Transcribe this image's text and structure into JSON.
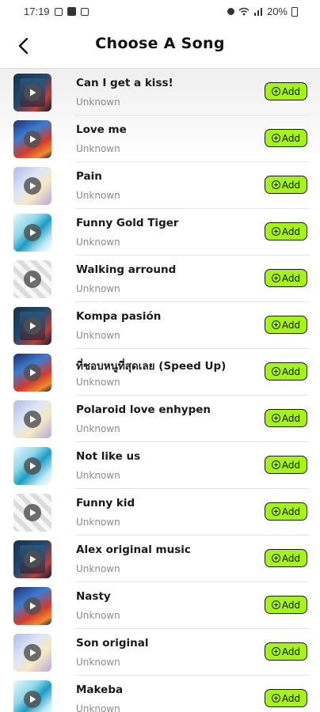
{
  "status_bar": {
    "time": "17:19",
    "battery": "20%",
    "icons": [
      "gallery-icon",
      "check-icon",
      "mail-icon",
      "alarm-icon",
      "wifi-icon",
      "signal-icon",
      "battery-icon"
    ]
  },
  "header": {
    "title": "Choose A Song",
    "back_icon": "arrow-left-icon"
  },
  "songs": [
    {
      "title": "Can I get a kiss!",
      "artist": "Unknown",
      "add_label": "Add",
      "thumb": "dark"
    },
    {
      "title": "Love me",
      "artist": "Unknown",
      "add_label": "Add",
      "thumb": "fire"
    },
    {
      "title": "Pain",
      "artist": "Unknown",
      "add_label": "Add",
      "thumb": "pastel"
    },
    {
      "title": "Funny Gold Tiger",
      "artist": "Unknown",
      "add_label": "Add",
      "thumb": "cyan"
    },
    {
      "title": "Walking arround",
      "artist": "Unknown",
      "add_label": "Add",
      "thumb": "pattern"
    },
    {
      "title": "Kompa pasión",
      "artist": "Unknown",
      "add_label": "Add",
      "thumb": "dark"
    },
    {
      "title": "ที่ชอบหนูที่สุดเลย (Speed Up)",
      "artist": "Unknown",
      "add_label": "Add",
      "thumb": "fire"
    },
    {
      "title": "Polaroid love enhypen",
      "artist": "Unknown",
      "add_label": "Add",
      "thumb": "pastel"
    },
    {
      "title": "Not like us",
      "artist": "Unknown",
      "add_label": "Add",
      "thumb": "cyan"
    },
    {
      "title": "Funny kid",
      "artist": "Unknown",
      "add_label": "Add",
      "thumb": "pattern"
    },
    {
      "title": "Alex original music",
      "artist": "Unknown",
      "add_label": "Add",
      "thumb": "dark"
    },
    {
      "title": "Nasty",
      "artist": "Unknown",
      "add_label": "Add",
      "thumb": "fire"
    },
    {
      "title": "Son original",
      "artist": "Unknown",
      "add_label": "Add",
      "thumb": "pastel"
    },
    {
      "title": "Makeba",
      "artist": "Unknown",
      "add_label": "Add",
      "thumb": "cyan"
    }
  ],
  "colors": {
    "add_button": "#a6f21a",
    "divider": "#e4e4e4",
    "artist_text": "#8a8a8a"
  }
}
